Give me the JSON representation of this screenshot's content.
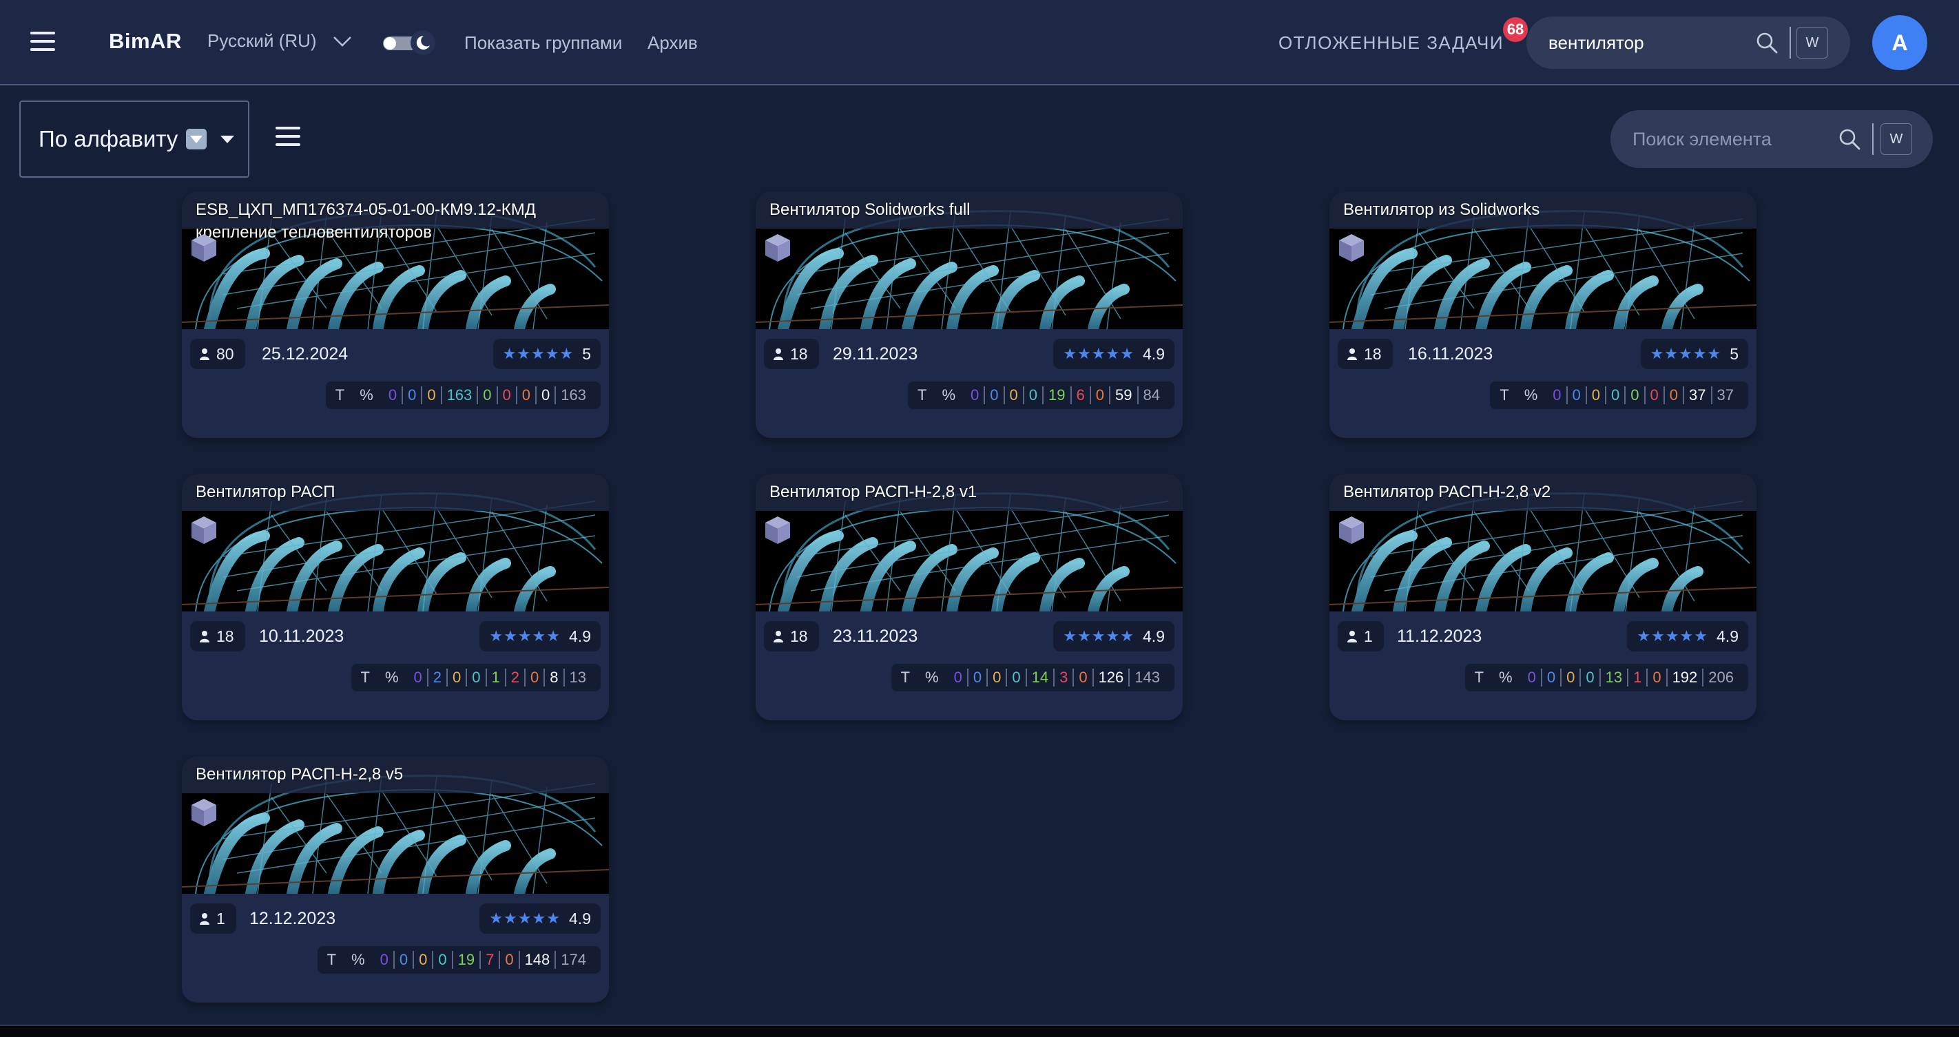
{
  "header": {
    "brand": "BimAR",
    "language": "Русский (RU)",
    "show_groups": "Показать группами",
    "archive": "Архив",
    "deferred_tasks": "ОТЛОЖЕННЫЕ ЗАДАЧИ",
    "deferred_count": "68",
    "search_value": "вентилятор",
    "search_key": "W",
    "avatar_letter": "A"
  },
  "toolbar": {
    "sort_label": "По алфавиту",
    "element_search_placeholder": "Поиск элемента",
    "element_search_key": "W"
  },
  "stats_labels": {
    "t": "T",
    "pct": "%"
  },
  "cards": [
    {
      "title": "ESB_ЦХП_МП176374-05-01-00-КМ9.12-КМД крепление тепловентиляторов",
      "users": "80",
      "date": "25.12.2024",
      "stars": "★★★★★",
      "rating": "5",
      "stats": [
        "0",
        "0",
        "0",
        "163",
        "0",
        "0",
        "0",
        "0",
        "163"
      ]
    },
    {
      "title": "Вентилятор Solidworks full",
      "users": "18",
      "date": "29.11.2023",
      "stars": "★★★★★",
      "rating": "4.9",
      "stats": [
        "0",
        "0",
        "0",
        "0",
        "19",
        "6",
        "0",
        "59",
        "84"
      ]
    },
    {
      "title": "Вентилятор из Solidworks",
      "users": "18",
      "date": "16.11.2023",
      "stars": "★★★★★",
      "rating": "5",
      "stats": [
        "0",
        "0",
        "0",
        "0",
        "0",
        "0",
        "0",
        "37",
        "37"
      ]
    },
    {
      "title": "Вентилятор РАСП",
      "users": "18",
      "date": "10.11.2023",
      "stars": "★★★★★",
      "rating": "4.9",
      "stats": [
        "0",
        "2",
        "0",
        "0",
        "1",
        "2",
        "0",
        "8",
        "13"
      ]
    },
    {
      "title": "Вентилятор РАСП-Н-2,8 v1",
      "users": "18",
      "date": "23.11.2023",
      "stars": "★★★★★",
      "rating": "4.9",
      "stats": [
        "0",
        "0",
        "0",
        "0",
        "14",
        "3",
        "0",
        "126",
        "143"
      ]
    },
    {
      "title": "Вентилятор РАСП-Н-2,8 v2",
      "users": "1",
      "date": "11.12.2023",
      "stars": "★★★★★",
      "rating": "4.9",
      "stats": [
        "0",
        "0",
        "0",
        "0",
        "13",
        "1",
        "0",
        "192",
        "206"
      ]
    },
    {
      "title": "Вентилятор РАСП-Н-2,8 v5",
      "users": "1",
      "date": "12.12.2023",
      "stars": "★★★★★",
      "rating": "4.9",
      "stats": [
        "0",
        "0",
        "0",
        "0",
        "19",
        "7",
        "0",
        "148",
        "174"
      ]
    }
  ],
  "colors": {
    "accent": "#3f80f4",
    "badge": "#e43a4f",
    "star": "#4e86ef",
    "stat_colors": [
      "#7b4fe0",
      "#4f8be8",
      "#e5b24c",
      "#4ec4c9",
      "#7fd15a",
      "#e84b5a",
      "#ea7a3c",
      "#f5f7fb",
      "#9ea7bb"
    ]
  }
}
